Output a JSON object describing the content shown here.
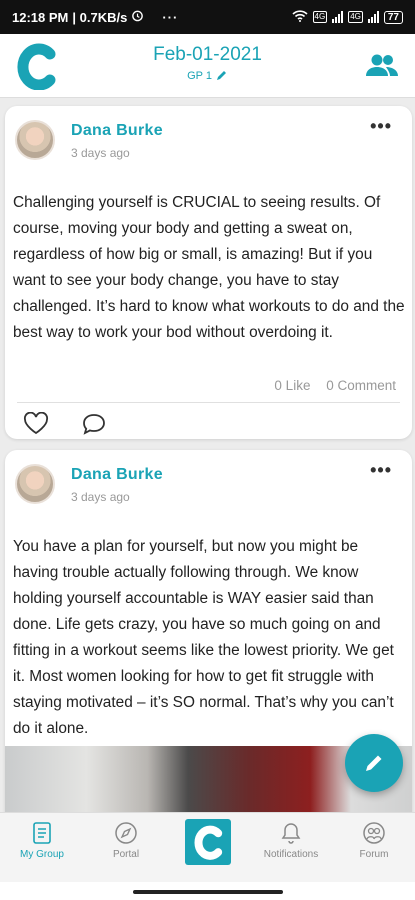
{
  "status_bar": {
    "time": "12:18 PM",
    "speed": "| 0.7KB/s",
    "more": "···",
    "battery": "77",
    "network_tag": "4G"
  },
  "header": {
    "date": "Feb-01-2021",
    "subtitle": "GP 1",
    "brand_color": "#1aa3b5"
  },
  "posts": [
    {
      "author": "Dana Burke",
      "time_ago": "3 days ago",
      "text": "Challenging yourself is CRUCIAL to seeing results. Of course, moving your body and getting a sweat on, regardless of how big or small, is amazing! But if you want to see your body change, you have to stay challenged. It’s hard to know what workouts to do and the best way to work your bod without overdoing it.",
      "likes": "0 Like",
      "comments": "0 Comment"
    },
    {
      "author": "Dana Burke",
      "time_ago": "3 days ago",
      "text": "You have a plan for yourself, but now you might be having trouble actually following through. We know holding yourself accountable is WAY easier said than done. Life gets crazy, you have so much going on and fitting in a workout seems like the lowest priority. We get it. Most women looking for how to get fit struggle with staying motivated – it’s SO normal. That’s why you can’t do it alone."
    }
  ],
  "tabs": {
    "my_group": "My Group",
    "portal": "Portal",
    "notifications": "Notifications",
    "forum": "Forum"
  }
}
